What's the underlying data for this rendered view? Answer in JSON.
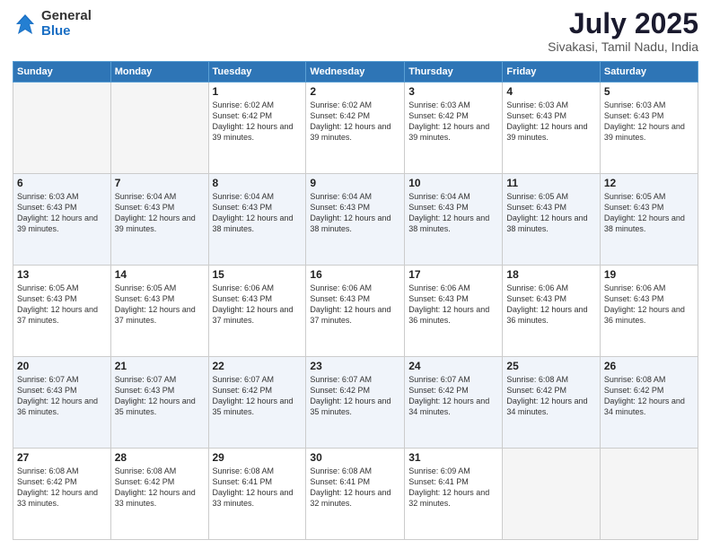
{
  "logo": {
    "general": "General",
    "blue": "Blue"
  },
  "title": "July 2025",
  "location": "Sivakasi, Tamil Nadu, India",
  "weekdays": [
    "Sunday",
    "Monday",
    "Tuesday",
    "Wednesday",
    "Thursday",
    "Friday",
    "Saturday"
  ],
  "weeks": [
    [
      {
        "day": "",
        "empty": true
      },
      {
        "day": "",
        "empty": true
      },
      {
        "day": "1",
        "sunrise": "6:02 AM",
        "sunset": "6:42 PM",
        "daylight": "12 hours and 39 minutes."
      },
      {
        "day": "2",
        "sunrise": "6:02 AM",
        "sunset": "6:42 PM",
        "daylight": "12 hours and 39 minutes."
      },
      {
        "day": "3",
        "sunrise": "6:03 AM",
        "sunset": "6:42 PM",
        "daylight": "12 hours and 39 minutes."
      },
      {
        "day": "4",
        "sunrise": "6:03 AM",
        "sunset": "6:43 PM",
        "daylight": "12 hours and 39 minutes."
      },
      {
        "day": "5",
        "sunrise": "6:03 AM",
        "sunset": "6:43 PM",
        "daylight": "12 hours and 39 minutes."
      }
    ],
    [
      {
        "day": "6",
        "sunrise": "6:03 AM",
        "sunset": "6:43 PM",
        "daylight": "12 hours and 39 minutes."
      },
      {
        "day": "7",
        "sunrise": "6:04 AM",
        "sunset": "6:43 PM",
        "daylight": "12 hours and 39 minutes."
      },
      {
        "day": "8",
        "sunrise": "6:04 AM",
        "sunset": "6:43 PM",
        "daylight": "12 hours and 38 minutes."
      },
      {
        "day": "9",
        "sunrise": "6:04 AM",
        "sunset": "6:43 PM",
        "daylight": "12 hours and 38 minutes."
      },
      {
        "day": "10",
        "sunrise": "6:04 AM",
        "sunset": "6:43 PM",
        "daylight": "12 hours and 38 minutes."
      },
      {
        "day": "11",
        "sunrise": "6:05 AM",
        "sunset": "6:43 PM",
        "daylight": "12 hours and 38 minutes."
      },
      {
        "day": "12",
        "sunrise": "6:05 AM",
        "sunset": "6:43 PM",
        "daylight": "12 hours and 38 minutes."
      }
    ],
    [
      {
        "day": "13",
        "sunrise": "6:05 AM",
        "sunset": "6:43 PM",
        "daylight": "12 hours and 37 minutes."
      },
      {
        "day": "14",
        "sunrise": "6:05 AM",
        "sunset": "6:43 PM",
        "daylight": "12 hours and 37 minutes."
      },
      {
        "day": "15",
        "sunrise": "6:06 AM",
        "sunset": "6:43 PM",
        "daylight": "12 hours and 37 minutes."
      },
      {
        "day": "16",
        "sunrise": "6:06 AM",
        "sunset": "6:43 PM",
        "daylight": "12 hours and 37 minutes."
      },
      {
        "day": "17",
        "sunrise": "6:06 AM",
        "sunset": "6:43 PM",
        "daylight": "12 hours and 36 minutes."
      },
      {
        "day": "18",
        "sunrise": "6:06 AM",
        "sunset": "6:43 PM",
        "daylight": "12 hours and 36 minutes."
      },
      {
        "day": "19",
        "sunrise": "6:06 AM",
        "sunset": "6:43 PM",
        "daylight": "12 hours and 36 minutes."
      }
    ],
    [
      {
        "day": "20",
        "sunrise": "6:07 AM",
        "sunset": "6:43 PM",
        "daylight": "12 hours and 36 minutes."
      },
      {
        "day": "21",
        "sunrise": "6:07 AM",
        "sunset": "6:43 PM",
        "daylight": "12 hours and 35 minutes."
      },
      {
        "day": "22",
        "sunrise": "6:07 AM",
        "sunset": "6:42 PM",
        "daylight": "12 hours and 35 minutes."
      },
      {
        "day": "23",
        "sunrise": "6:07 AM",
        "sunset": "6:42 PM",
        "daylight": "12 hours and 35 minutes."
      },
      {
        "day": "24",
        "sunrise": "6:07 AM",
        "sunset": "6:42 PM",
        "daylight": "12 hours and 34 minutes."
      },
      {
        "day": "25",
        "sunrise": "6:08 AM",
        "sunset": "6:42 PM",
        "daylight": "12 hours and 34 minutes."
      },
      {
        "day": "26",
        "sunrise": "6:08 AM",
        "sunset": "6:42 PM",
        "daylight": "12 hours and 34 minutes."
      }
    ],
    [
      {
        "day": "27",
        "sunrise": "6:08 AM",
        "sunset": "6:42 PM",
        "daylight": "12 hours and 33 minutes."
      },
      {
        "day": "28",
        "sunrise": "6:08 AM",
        "sunset": "6:42 PM",
        "daylight": "12 hours and 33 minutes."
      },
      {
        "day": "29",
        "sunrise": "6:08 AM",
        "sunset": "6:41 PM",
        "daylight": "12 hours and 33 minutes."
      },
      {
        "day": "30",
        "sunrise": "6:08 AM",
        "sunset": "6:41 PM",
        "daylight": "12 hours and 32 minutes."
      },
      {
        "day": "31",
        "sunrise": "6:09 AM",
        "sunset": "6:41 PM",
        "daylight": "12 hours and 32 minutes."
      },
      {
        "day": "",
        "empty": true
      },
      {
        "day": "",
        "empty": true
      }
    ]
  ],
  "labels": {
    "sunrise": "Sunrise:",
    "sunset": "Sunset:",
    "daylight": "Daylight:"
  }
}
